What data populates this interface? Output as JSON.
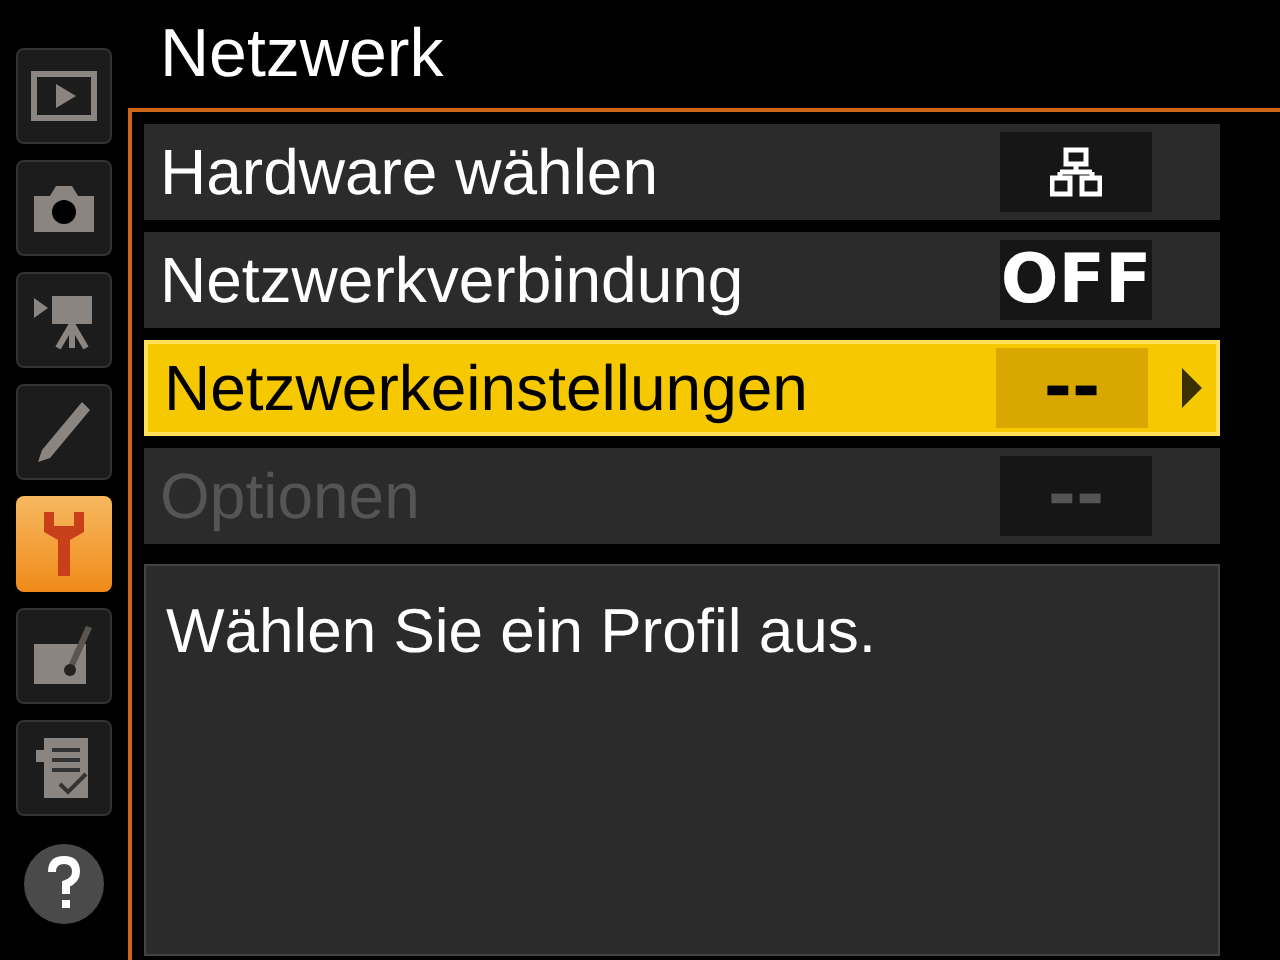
{
  "title": "Netzwerk",
  "sidebar": [
    {
      "kind": "playback",
      "selected": false
    },
    {
      "kind": "camera",
      "selected": false
    },
    {
      "kind": "movie",
      "selected": false
    },
    {
      "kind": "pencil",
      "selected": false
    },
    {
      "kind": "wrench",
      "selected": true
    },
    {
      "kind": "retouch",
      "selected": false
    },
    {
      "kind": "recent",
      "selected": false
    },
    {
      "kind": "help",
      "selected": false
    }
  ],
  "items": [
    {
      "label": "Hardware wählen",
      "kind": "icon",
      "selected": false,
      "disabled": false
    },
    {
      "label": "Netzwerkverbindung",
      "kind": "text",
      "value": "OFF",
      "selected": false,
      "disabled": false
    },
    {
      "label": "Netzwerkeinstellungen",
      "kind": "text",
      "value": "--",
      "selected": true,
      "disabled": false
    },
    {
      "label": "Optionen",
      "kind": "text",
      "value": "--",
      "selected": false,
      "disabled": true
    }
  ],
  "help_text": "Wählen Sie ein Profil aus."
}
